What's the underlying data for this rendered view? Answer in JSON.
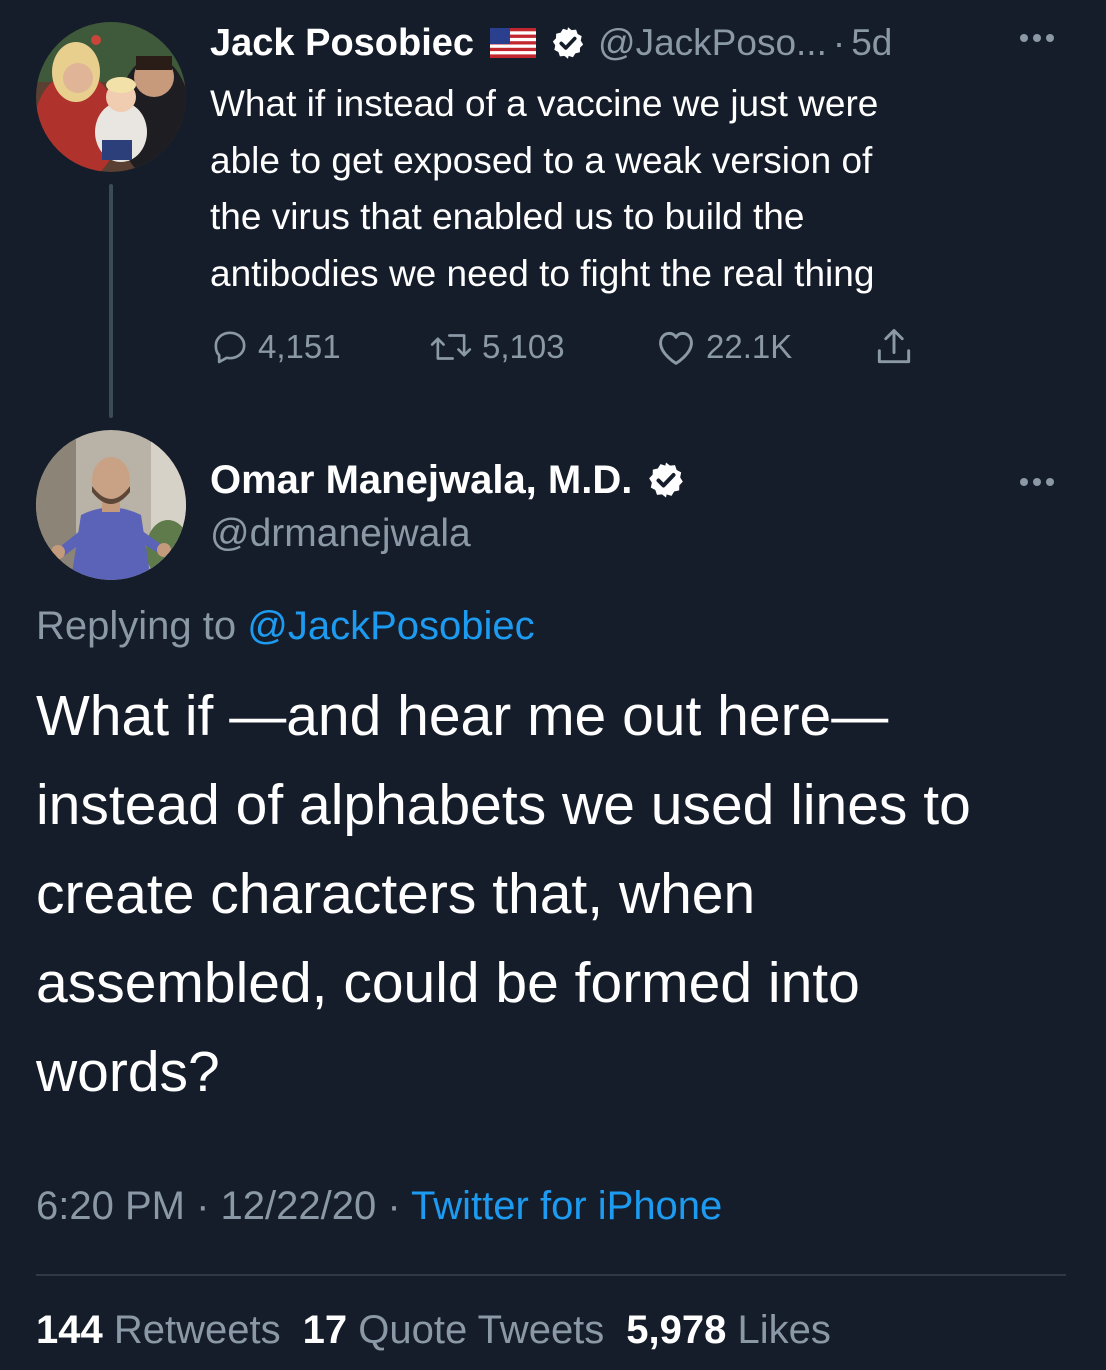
{
  "tweet1": {
    "author_name": "Jack Posobiec",
    "handle": "@JackPoso...",
    "separator": "·",
    "time": "5d",
    "text_lines": [
      "What if instead of a vaccine we just were",
      "able to get exposed to a weak version of",
      "the virus that enabled us to build the",
      "antibodies we need to fight the real thing"
    ],
    "replies": "4,151",
    "retweets": "5,103",
    "likes": "22.1K",
    "flag_icon": "us-flag-icon",
    "verified_icon": "verified-badge-icon"
  },
  "tweet2": {
    "author_name": "Omar Manejwala, M.D.",
    "handle": "@drmanejwala",
    "replying_prefix": "Replying to ",
    "replying_to": "@JackPosobiec",
    "text_lines": [
      "What if —and hear me out here—",
      "instead of alphabets we used lines to",
      "create characters that, when",
      "assembled, could be formed into",
      "words?"
    ],
    "time": "6:20 PM",
    "separator": " · ",
    "date": "12/22/20",
    "source": "Twitter for iPhone",
    "retweets_count": "144",
    "retweets_label": " Retweets",
    "quote_count": "17",
    "quote_label": " Quote Tweets",
    "likes_count": "5,978",
    "likes_label": " Likes"
  },
  "colors": {
    "background": "#151d2a",
    "text_primary": "#ffffff",
    "text_secondary": "#8b98a5",
    "link": "#1d9bf0",
    "divider": "#2f3a46"
  }
}
